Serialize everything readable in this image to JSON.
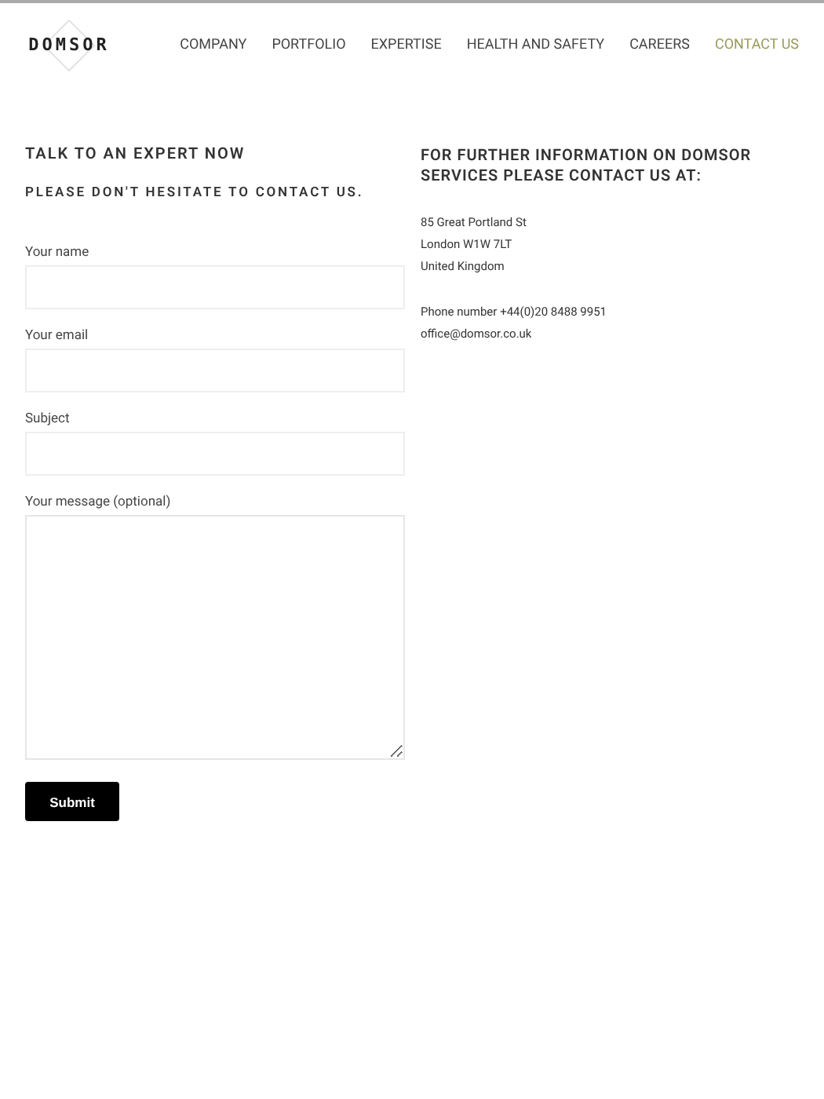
{
  "header": {
    "logo": "DOMSOR",
    "nav": [
      {
        "label": "COMPANY",
        "selected": false
      },
      {
        "label": "PORTFOLIO",
        "selected": false
      },
      {
        "label": "EXPERTISE",
        "selected": false
      },
      {
        "label": "HEALTH AND SAFETY",
        "selected": false
      },
      {
        "label": "CAREERS",
        "selected": false
      },
      {
        "label": "CONTACT US",
        "selected": true
      }
    ]
  },
  "form": {
    "title": "TALK TO AN EXPERT NOW",
    "subtitle": "PLEASE DON'T HESITATE TO CONTACT US.",
    "fields": [
      {
        "label": "Your name",
        "kind": "input"
      },
      {
        "label": "Your email",
        "kind": "input"
      },
      {
        "label": "Subject",
        "kind": "input"
      },
      {
        "label": "Your message (optional)",
        "kind": "textarea"
      }
    ],
    "submit": "Submit"
  },
  "contact": {
    "title": "FOR FURTHER INFORMATION ON DOMSOR SERVICES PLEASE CONTACT US AT:",
    "blocks": [
      [
        "85 Great Portland St",
        "London W1W 7LT",
        "United Kingdom"
      ],
      [
        "Phone number +44(0)20 8488 9951",
        "office@domsor.co.uk"
      ]
    ]
  }
}
